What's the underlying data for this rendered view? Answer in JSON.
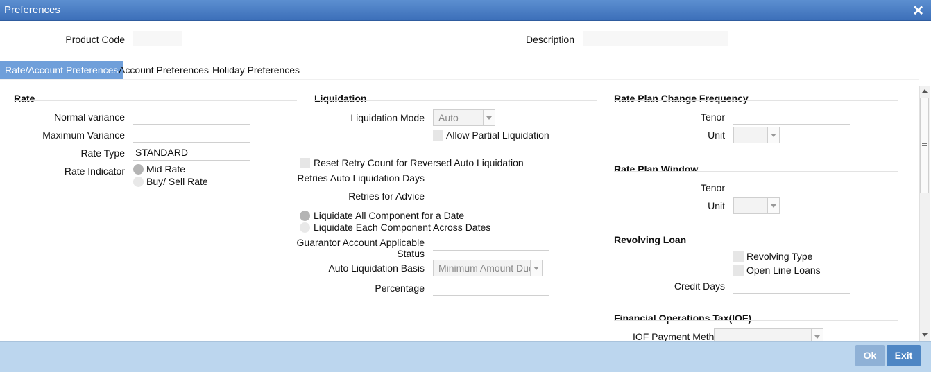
{
  "window": {
    "title": "Preferences",
    "close_glyph": "✕"
  },
  "top": {
    "product_code_label": "Product Code",
    "product_code_value": "",
    "description_label": "Description",
    "description_value": ""
  },
  "tabs": [
    {
      "label": "Rate/Account Preferences",
      "active": true
    },
    {
      "label": "Account Preferences",
      "active": false
    },
    {
      "label": "Holiday Preferences",
      "active": false
    }
  ],
  "rate": {
    "header": "Rate",
    "normal_variance_label": "Normal variance",
    "normal_variance_value": "",
    "maximum_variance_label": "Maximum Variance",
    "maximum_variance_value": "",
    "rate_type_label": "Rate Type",
    "rate_type_value": "STANDARD",
    "rate_indicator_label": "Rate Indicator",
    "rate_indicator_options": [
      {
        "label": "Mid Rate",
        "selected": true
      },
      {
        "label": "Buy/ Sell Rate",
        "selected": false
      }
    ]
  },
  "liquidation": {
    "header": "Liquidation",
    "mode_label": "Liquidation Mode",
    "mode_value": "Auto",
    "allow_partial_label": "Allow Partial Liquidation",
    "allow_partial_checked": false,
    "reset_retry_label": "Reset Retry Count for Reversed Auto Liquidation",
    "reset_retry_checked": false,
    "retries_days_label": "Retries Auto Liquidation Days",
    "retries_days_value": "",
    "retries_advice_label": "Retries for Advice",
    "retries_advice_value": "",
    "component_options": [
      {
        "label": "Liquidate All Component for a Date",
        "selected": true
      },
      {
        "label": "Liquidate Each Component Across Dates",
        "selected": false
      }
    ],
    "guarantor_label_line1": "Guarantor Account Applicable",
    "guarantor_label_line2": "Status",
    "guarantor_value": "",
    "basis_label": "Auto Liquidation Basis",
    "basis_value": "Minimum Amount Due",
    "percentage_label": "Percentage",
    "percentage_value": ""
  },
  "rate_plan_change": {
    "header": "Rate Plan Change Frequency",
    "tenor_label": "Tenor",
    "tenor_value": "",
    "unit_label": "Unit",
    "unit_value": ""
  },
  "rate_plan_window": {
    "header": "Rate Plan Window",
    "tenor_label": "Tenor",
    "tenor_value": "",
    "unit_label": "Unit",
    "unit_value": ""
  },
  "revolving_loan": {
    "header": "Revolving Loan",
    "revolving_type_label": "Revolving Type",
    "revolving_type_checked": false,
    "open_line_label": "Open Line Loans",
    "open_line_checked": false,
    "credit_days_label": "Credit Days",
    "credit_days_value": ""
  },
  "iof": {
    "header": "Financial Operations Tax(IOF)",
    "payment_method_label": "IOF Payment Method",
    "payment_method_value": ""
  },
  "footer": {
    "ok_label": "Ok",
    "exit_label": "Exit"
  },
  "colors": {
    "titlebar": "#3c6fb9",
    "active_tab": "#6f9fda",
    "footer": "#bcd6ee",
    "ok_button": "#8fb1d6",
    "exit_button": "#4e86c4"
  }
}
